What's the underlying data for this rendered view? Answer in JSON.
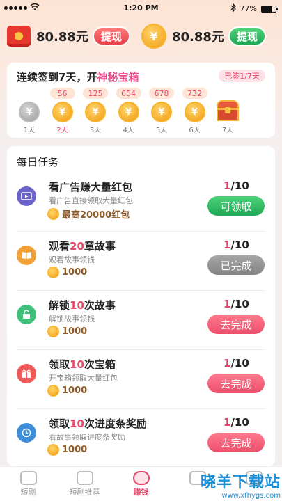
{
  "status_bar": {
    "time": "1:20 PM",
    "battery": "77%",
    "battery_level": 0.77
  },
  "balance": {
    "left_amount": "80.88元",
    "left_button": "提现",
    "right_coin": "¥",
    "right_amount": "80.88元",
    "right_button": "提现"
  },
  "signin": {
    "title_prefix": "连续签到7天，开",
    "title_highlight": "神秘宝箱",
    "badge": "已签1/7天",
    "coin_symbol": "¥",
    "days": [
      {
        "label": "1天",
        "reward": "",
        "state": "done"
      },
      {
        "label": "2天",
        "reward": "56",
        "state": "active"
      },
      {
        "label": "3天",
        "reward": "125",
        "state": "normal"
      },
      {
        "label": "4天",
        "reward": "654",
        "state": "normal"
      },
      {
        "label": "5天",
        "reward": "678",
        "state": "normal"
      },
      {
        "label": "6天",
        "reward": "732",
        "state": "normal"
      },
      {
        "label": "7天",
        "reward": "",
        "state": "chest"
      }
    ]
  },
  "tasks": {
    "title": "每日任务",
    "items": [
      {
        "name": "看广告赚大量红包",
        "name_pre": "看广告赚大量红包",
        "name_hl": "",
        "name_post": "",
        "desc": "看广告直接领取大量红包",
        "reward": "最高20000红包",
        "progress_cur": "1",
        "progress_total": "/10",
        "button": "可领取",
        "button_style": "green",
        "icon": "video-icon",
        "icon_color": "#6b63c9"
      },
      {
        "name": "观看20章故事",
        "name_pre": "观看",
        "name_hl": "20",
        "name_post": "章故事",
        "desc": "观看故事领钱",
        "reward": "1000",
        "progress_cur": "1",
        "progress_total": "/10",
        "button": "已完成",
        "button_style": "grey",
        "icon": "book-icon",
        "icon_color": "#f0a035"
      },
      {
        "name": "解锁10次故事",
        "name_pre": "解锁",
        "name_hl": "10",
        "name_post": "次故事",
        "desc": "解锁故事领钱",
        "reward": "1000",
        "progress_cur": "1",
        "progress_total": "/10",
        "button": "去完成",
        "button_style": "pink",
        "icon": "unlock-icon",
        "icon_color": "#3fbf7a"
      },
      {
        "name": "领取10次宝箱",
        "name_pre": "领取",
        "name_hl": "10",
        "name_post": "次宝箱",
        "desc": "开宝箱领取大量红包",
        "reward": "1000",
        "progress_cur": "1",
        "progress_total": "/10",
        "button": "去完成",
        "button_style": "pink",
        "icon": "gift-icon",
        "icon_color": "#ef5a5a"
      },
      {
        "name": "领取10次进度条奖励",
        "name_pre": "领取",
        "name_hl": "10",
        "name_post": "次进度条奖励",
        "desc": "看故事领取进度条奖励",
        "reward": "1000",
        "progress_cur": "1",
        "progress_total": "/10",
        "button": "去完成",
        "button_style": "pink",
        "icon": "clock-icon",
        "icon_color": "#3f8fd8"
      }
    ]
  },
  "nav": {
    "items": [
      {
        "label": "短剧",
        "active": false
      },
      {
        "label": "短剧推荐",
        "active": false
      },
      {
        "label": "赚钱",
        "active": true
      },
      {
        "label": "",
        "active": false
      },
      {
        "label": "",
        "active": false
      }
    ]
  },
  "watermark": {
    "title": "晓羊下载站",
    "url": "www.xfhygs.com"
  },
  "colors": {
    "accent_pink": "#e8426a",
    "green": "#1ea855",
    "coin": "#f29a11"
  }
}
